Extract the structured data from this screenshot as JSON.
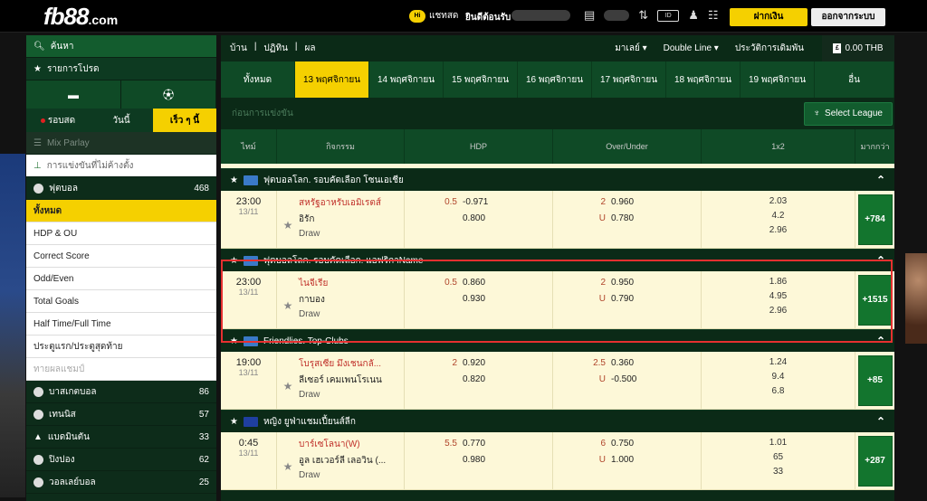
{
  "header": {
    "logo": "fb88",
    "logo_suffix": ".com",
    "chat_badge": "Hi",
    "chat_label": "แชทสด",
    "welcome": "ยินดีต้อนรับ",
    "deposit_btn": "ฝากเงิน",
    "logout_btn": "ออกจากระบบ",
    "icon_box": "ID"
  },
  "sidebar": {
    "search": "ค้นหา",
    "favorites": "รายการโปรด",
    "tabs": [
      "รอบสด",
      "วันนี้",
      "เร็ว ๆ นี้"
    ],
    "mix_parlay": "Mix Parlay",
    "pending": "การแข่งขันที่ไม่ค้างตั้ง",
    "football": {
      "label": "ฟุตบอล",
      "count": "468"
    },
    "sub_items": [
      "ทั้งหมด",
      "HDP & OU",
      "Correct Score",
      "Odd/Even",
      "Total Goals",
      "Half Time/Full Time",
      "ประตูแรก/ประตูสุดท้าย",
      "ทายผลแชมป์"
    ],
    "sports": [
      {
        "label": "บาสเกตบอล",
        "count": "86"
      },
      {
        "label": "เทนนิส",
        "count": "57"
      },
      {
        "label": "แบดมินตัน",
        "count": "33"
      },
      {
        "label": "ปิงปอง",
        "count": "62"
      },
      {
        "label": "วอลเลย์บอล",
        "count": "25"
      }
    ]
  },
  "nav": {
    "crumbs": [
      "บ้าน",
      "|",
      "ปฏิทิน",
      "|",
      "ผล"
    ],
    "market": "มาเลย์",
    "line": "Double Line",
    "history": "ประวัติการเดิมพัน",
    "balance_icon": "£",
    "balance": "0.00 THB"
  },
  "date_tabs": [
    "ทั้งหมด",
    "13 พฤศจิกายน",
    "14 พฤศจิกายน",
    "15 พฤศจิกายน",
    "16 พฤศจิกายน",
    "17 พฤศจิกายน",
    "18 พฤศจิกายน",
    "19 พฤศจิกายน",
    "อื่น"
  ],
  "pre_match": "ก่อนการแข่งขัน",
  "select_league": "Select League",
  "columns": [
    "ไทม์",
    "กิจกรรม",
    "HDP",
    "Over/Under",
    "1x2",
    "มากกว่า"
  ],
  "leagues": [
    {
      "name": "ฟุตบอลโลก. รอบคัดเลือก โซนเอเชีย",
      "match": {
        "time": "23:00",
        "date": "13/11",
        "home": "สหรัฐอาหรับเอมิเรตส์",
        "away": "อิรัก",
        "draw": "Draw",
        "hdp_line": "0.5",
        "hdp_home": "-0.971",
        "hdp_away": "0.800",
        "ou_line": "2",
        "ou_u": "U",
        "ou_over": "0.960",
        "ou_under": "0.780",
        "x1": "2.03",
        "x2": "4.2",
        "x3": "2.96",
        "more": "+784"
      }
    },
    {
      "name": "ฟุตบอลโลก. รอบคัดเลือก. แอฟริกาName",
      "match": {
        "time": "23:00",
        "date": "13/11",
        "home": "ไนจีเรีย",
        "away": "กาบอง",
        "draw": "Draw",
        "hdp_line": "0.5",
        "hdp_home": "0.860",
        "hdp_away": "0.930",
        "ou_line": "2",
        "ou_u": "U",
        "ou_over": "0.950",
        "ou_under": "0.790",
        "x1": "1.86",
        "x2": "4.95",
        "x3": "2.96",
        "more": "+1515"
      }
    },
    {
      "name": "Friendlies. Top-Clubs",
      "match": {
        "time": "19:00",
        "date": "13/11",
        "home": "โบรุสเซีย มึงเชนกลั...",
        "away": "ลีเซอร์ เคมเพนโรเนน",
        "draw": "Draw",
        "hdp_line": "2",
        "hdp_home": "0.920",
        "hdp_away": "0.820",
        "ou_line": "2.5",
        "ou_u": "U",
        "ou_over": "0.360",
        "ou_under": "-0.500",
        "x1": "1.24",
        "x2": "9.4",
        "x3": "6.8",
        "more": "+85"
      }
    },
    {
      "name": "หญิง ยูฟ่าแชมเปี้ยนส์ลีก",
      "match": {
        "time": "0:45",
        "date": "13/11",
        "home": "บาร์เซโลนา(W)",
        "away": "อูล เฮเวอร์ลี เลอวิน (...",
        "draw": "Draw",
        "hdp_line": "5.5",
        "hdp_home": "0.770",
        "hdp_away": "0.980",
        "ou_line": "6",
        "ou_u": "U",
        "ou_over": "0.750",
        "ou_under": "1.000",
        "x1": "1.01",
        "x2": "65",
        "x3": "33",
        "more": "+287"
      }
    }
  ]
}
